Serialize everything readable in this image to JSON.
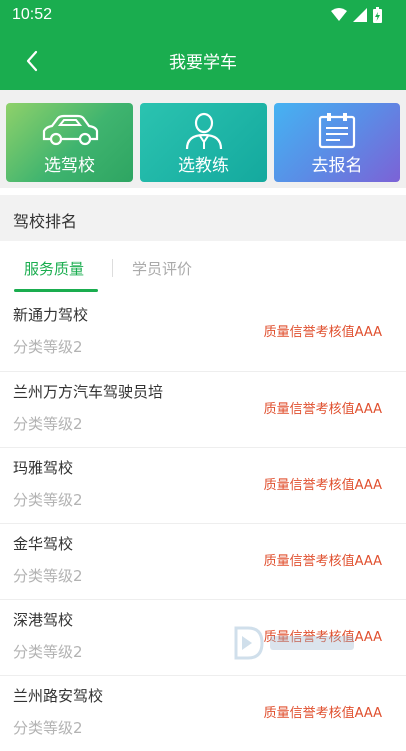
{
  "status_bar": {
    "time": "10:52"
  },
  "title_bar": {
    "title": "我要学车"
  },
  "tiles": [
    {
      "label": "选驾校",
      "icon": "car-icon"
    },
    {
      "label": "选教练",
      "icon": "instructor-icon"
    },
    {
      "label": "去报名",
      "icon": "signup-form-icon"
    }
  ],
  "section": {
    "title": "驾校排名"
  },
  "tabs": [
    {
      "label": "服务质量",
      "active": true
    },
    {
      "label": "学员评价",
      "active": false
    }
  ],
  "schools": [
    {
      "name": "新通力驾校",
      "level": "分类等级2",
      "rating": "质量信誉考核值AAA"
    },
    {
      "name": "兰州万方汽车驾驶员培",
      "level": "分类等级2",
      "rating": "质量信誉考核值AAA"
    },
    {
      "name": "玛雅驾校",
      "level": "分类等级2",
      "rating": "质量信誉考核值AAA"
    },
    {
      "name": "金华驾校",
      "level": "分类等级2",
      "rating": "质量信誉考核值AAA"
    },
    {
      "name": "深港驾校",
      "level": "分类等级2",
      "rating": "质量信誉考核值AAA"
    },
    {
      "name": "兰州路安驾校",
      "level": "分类等级2",
      "rating": "质量信誉考核值AAA"
    }
  ],
  "colors": {
    "brand": "#1aad4f",
    "rating": "#e0502f"
  }
}
